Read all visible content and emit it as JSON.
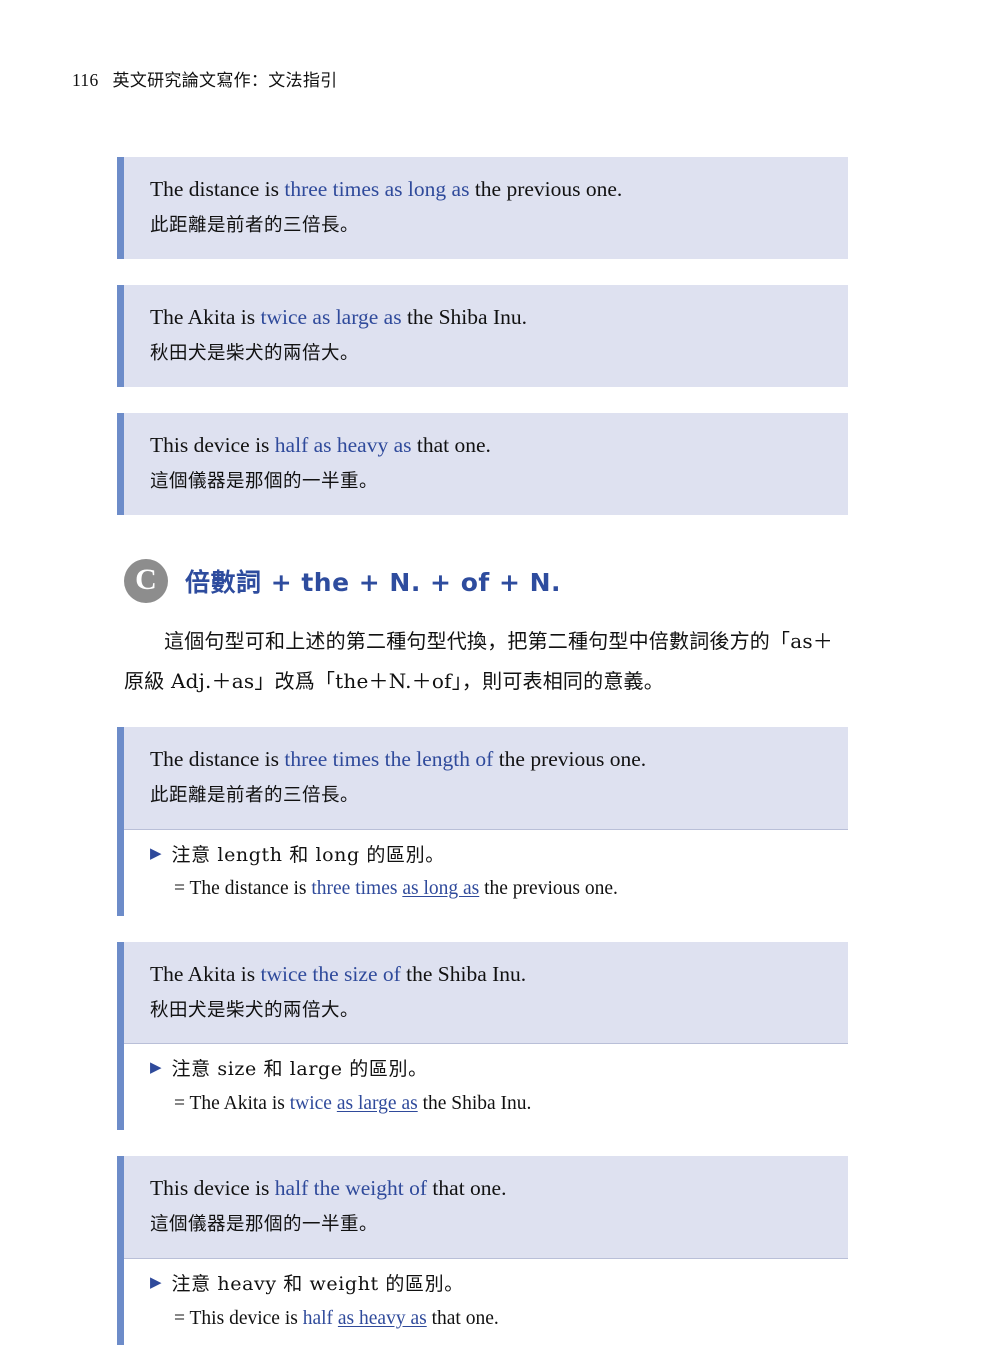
{
  "header": {
    "folio": "116",
    "book_title": "英文研究論文寫作：文法指引"
  },
  "top_examples": [
    {
      "en_before": "The distance is ",
      "en_highlight": "three times as long as",
      "en_after": " the previous one.",
      "zh": "此距離是前者的三倍長。"
    },
    {
      "en_before": "The Akita is ",
      "en_highlight": "twice as large as",
      "en_after": " the Shiba Inu.",
      "zh": "秋田犬是柴犬的兩倍大。"
    },
    {
      "en_before": "This device is ",
      "en_highlight": "half as heavy as",
      "en_after": " that one.",
      "zh": "這個儀器是那個的一半重。"
    }
  ],
  "section": {
    "badge": "C",
    "heading": "倍數詞 + the + N. + of + N.",
    "paragraph": "這個句型可和上述的第二種句型代換，把第二種句型中倍數詞後方的「as＋原級 Adj.＋as」改爲「the＋N.＋of」，則可表相同的意義。"
  },
  "section_examples": [
    {
      "en_before": "The distance is ",
      "en_highlight": "three times the length of",
      "en_after": " the previous one.",
      "zh": "此距離是前者的三倍長。",
      "note": {
        "bullet": "triangle-right-icon",
        "text": "注意 length 和 long 的區別。",
        "eq_prefix": "= The distance is ",
        "eq_blue": "three times ",
        "eq_underline": "as long as",
        "eq_suffix": " the previous one."
      }
    },
    {
      "en_before": "The Akita is ",
      "en_highlight": "twice the size of",
      "en_after": " the Shiba Inu.",
      "zh": "秋田犬是柴犬的兩倍大。",
      "note": {
        "bullet": "triangle-right-icon",
        "text": "注意 size 和 large 的區別。",
        "eq_prefix": "= The Akita is ",
        "eq_blue": "twice ",
        "eq_underline": "as large as",
        "eq_suffix": " the Shiba Inu."
      }
    },
    {
      "en_before": "This device is ",
      "en_highlight": "half the weight of",
      "en_after": " that one.",
      "zh": "這個儀器是那個的一半重。",
      "note": {
        "bullet": "triangle-right-icon",
        "text": "注意 heavy 和 weight 的區別。",
        "eq_prefix": "= This device is ",
        "eq_blue": "half ",
        "eq_underline": "as heavy as",
        "eq_suffix": " that one."
      }
    }
  ],
  "colors": {
    "accent_bar": "#6d8cc9",
    "box_background": "#dee1f0",
    "highlight_text": "#2f4a9b",
    "heading_text": "#2e4c9e",
    "badge_background": "#8d8d8d",
    "page_background": "#ffffff"
  }
}
